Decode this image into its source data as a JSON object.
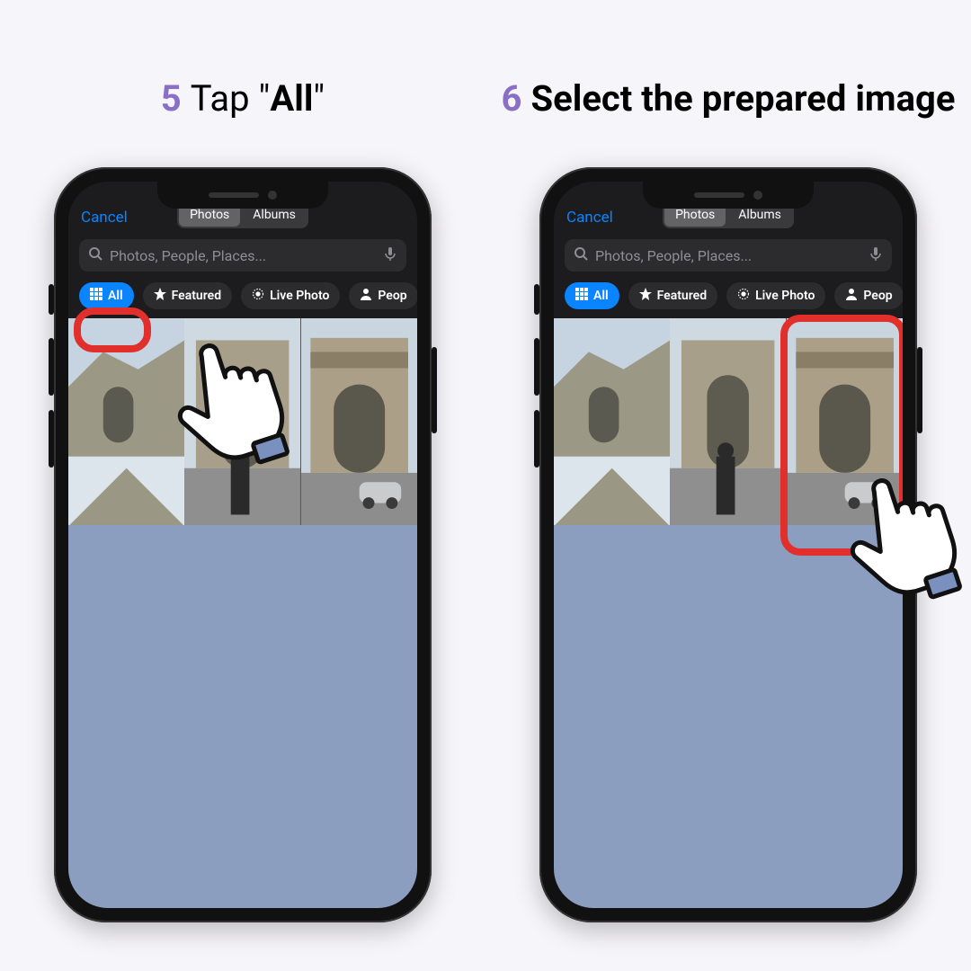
{
  "steps": [
    {
      "num": "5",
      "pre": "Tap \"",
      "bold": "All",
      "post": "\""
    },
    {
      "num": "6",
      "bold": "Select the prepared image"
    }
  ],
  "picker": {
    "cancel": "Cancel",
    "seg": {
      "photos": "Photos",
      "albums": "Albums"
    },
    "search_placeholder": "Photos, People, Places...",
    "chips": {
      "all": "All",
      "featured": "Featured",
      "live": "Live Photo",
      "people": "Peop"
    }
  }
}
